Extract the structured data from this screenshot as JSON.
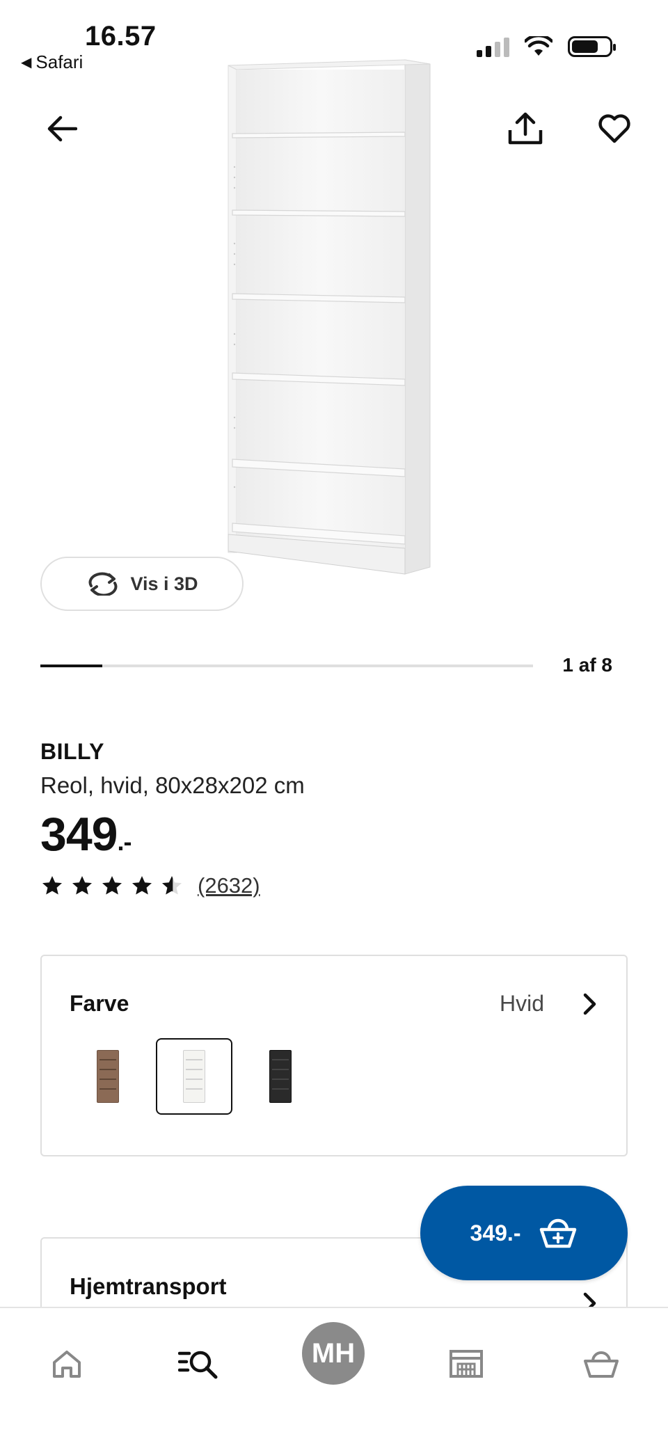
{
  "status_bar": {
    "time": "16.57",
    "back_app": "Safari",
    "back_arrow": "◀"
  },
  "nav": {
    "back_icon": "arrow-left-icon",
    "share_icon": "share-icon",
    "favorite_icon": "heart-icon"
  },
  "gallery": {
    "view_3d_label": "Vis i 3D",
    "position_label": "1 af 8",
    "current_index": 1,
    "total": 8
  },
  "product": {
    "name": "BILLY",
    "description": "Reol, hvid, 80x28x202 cm",
    "price": "349",
    "price_suffix": ".-",
    "rating": 4.6,
    "rating_max": 5,
    "review_count": "(2632)"
  },
  "color_selector": {
    "title": "Farve",
    "selected_value": "Hvid",
    "swatches": [
      {
        "name": "brown-ash",
        "color": "#8b6a55"
      },
      {
        "name": "white",
        "color": "#f1f1ee",
        "selected": true
      },
      {
        "name": "black",
        "color": "#2a2a2a"
      }
    ]
  },
  "delivery": {
    "title": "Hjemtransport"
  },
  "cart_button": {
    "label": "349.-"
  },
  "tabbar": {
    "profile_initials": "MH",
    "items": [
      "home-icon",
      "search-icon",
      "profile-avatar",
      "store-icon",
      "cart-icon"
    ]
  },
  "colors": {
    "accent_blue": "#0058a3",
    "border_gray": "#dfdfdf",
    "avatar_gray": "#8a8a8a"
  }
}
